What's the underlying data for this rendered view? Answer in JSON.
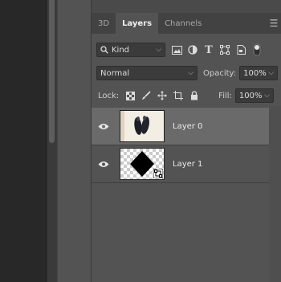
{
  "tabs": [
    {
      "label": "3D",
      "active": false
    },
    {
      "label": "Layers",
      "active": true
    },
    {
      "label": "Channels",
      "active": false
    }
  ],
  "panel_menu_icon": "hamburger-menu-icon",
  "filter": {
    "kind_label": "Kind",
    "icons": [
      "image-filter-icon",
      "adjustment-filter-icon",
      "type-filter-icon",
      "shape-filter-icon",
      "smart-object-filter-icon",
      "filter-toggle-icon"
    ]
  },
  "blend": {
    "mode": "Normal",
    "opacity_label": "Opacity:",
    "opacity_value": "100%"
  },
  "lock": {
    "label": "Lock:",
    "icons": [
      "lock-transparent-pixels-icon",
      "lock-image-pixels-icon",
      "lock-position-icon",
      "artboard-nesting-icon",
      "lock-all-icon"
    ],
    "fill_label": "Fill:",
    "fill_value": "100%"
  },
  "layers": [
    {
      "name": "Layer 0",
      "visible": true,
      "selected": true
    },
    {
      "name": "Layer 1",
      "visible": true,
      "selected": false
    }
  ]
}
